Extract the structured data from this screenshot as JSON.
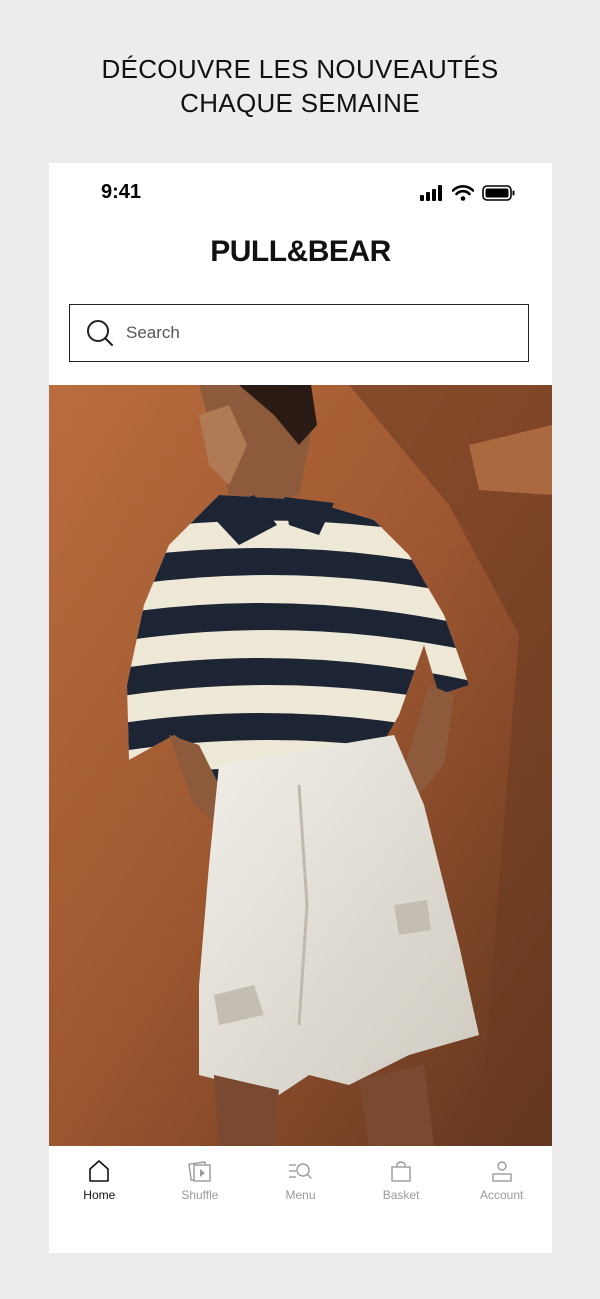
{
  "promo": {
    "line1": "DÉCOUVRE LES NOUVEAUTÉS",
    "line2": "CHAQUE SEMAINE"
  },
  "status_bar": {
    "time": "9:41",
    "icons": [
      "signal-icon",
      "wifi-icon",
      "battery-icon"
    ]
  },
  "header": {
    "brand": "PULL&BEAR"
  },
  "search": {
    "placeholder": "Search",
    "icon": "search-icon"
  },
  "hero": {
    "description_icon": "hero-image"
  },
  "tabbar": {
    "items": [
      {
        "label": "Home",
        "icon": "home-icon",
        "active": true
      },
      {
        "label": "Shuffle",
        "icon": "shuffle-icon",
        "active": false
      },
      {
        "label": "Menu",
        "icon": "menu-search-icon",
        "active": false
      },
      {
        "label": "Basket",
        "icon": "basket-icon",
        "active": false
      },
      {
        "label": "Account",
        "icon": "account-icon",
        "active": false
      }
    ]
  },
  "colors": {
    "background": "#ececec",
    "text": "#111111",
    "inactive": "#9a9a9a",
    "hero_wall": "#a25b31"
  }
}
